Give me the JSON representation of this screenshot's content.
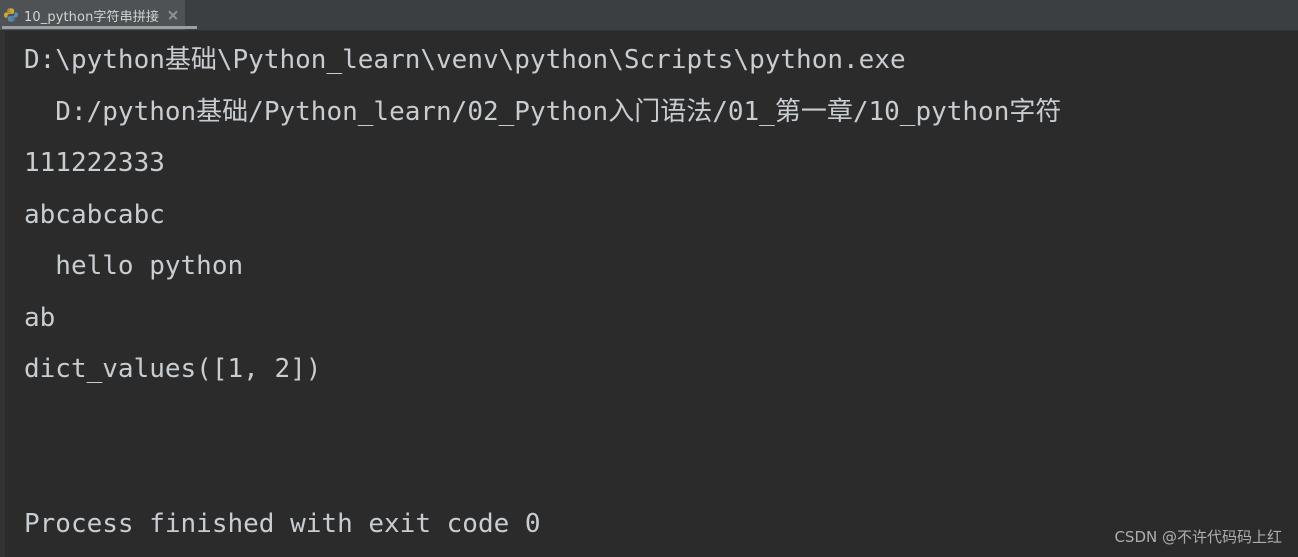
{
  "window": {
    "background_color": "#2b2b2b",
    "tabbar_background_color": "#3c3f41",
    "console_text_color": "#c8cdd2"
  },
  "tabbar": {
    "active_tab": {
      "label": "10_python字符串拼接",
      "icon": "python-file-icon",
      "close_label": "×"
    }
  },
  "console": {
    "lines": [
      "D:\\python基础\\Python_learn\\venv\\python\\Scripts\\python.exe",
      "  D:/python基础/Python_learn/02_Python入门语法/01_第一章/10_python字符",
      "111222333",
      "abcabcabc",
      "  hello python",
      "ab",
      "dict_values([1, 2])",
      "",
      "",
      "Process finished with exit code 0"
    ]
  },
  "watermark": {
    "text": "CSDN @不许代码码上红"
  }
}
